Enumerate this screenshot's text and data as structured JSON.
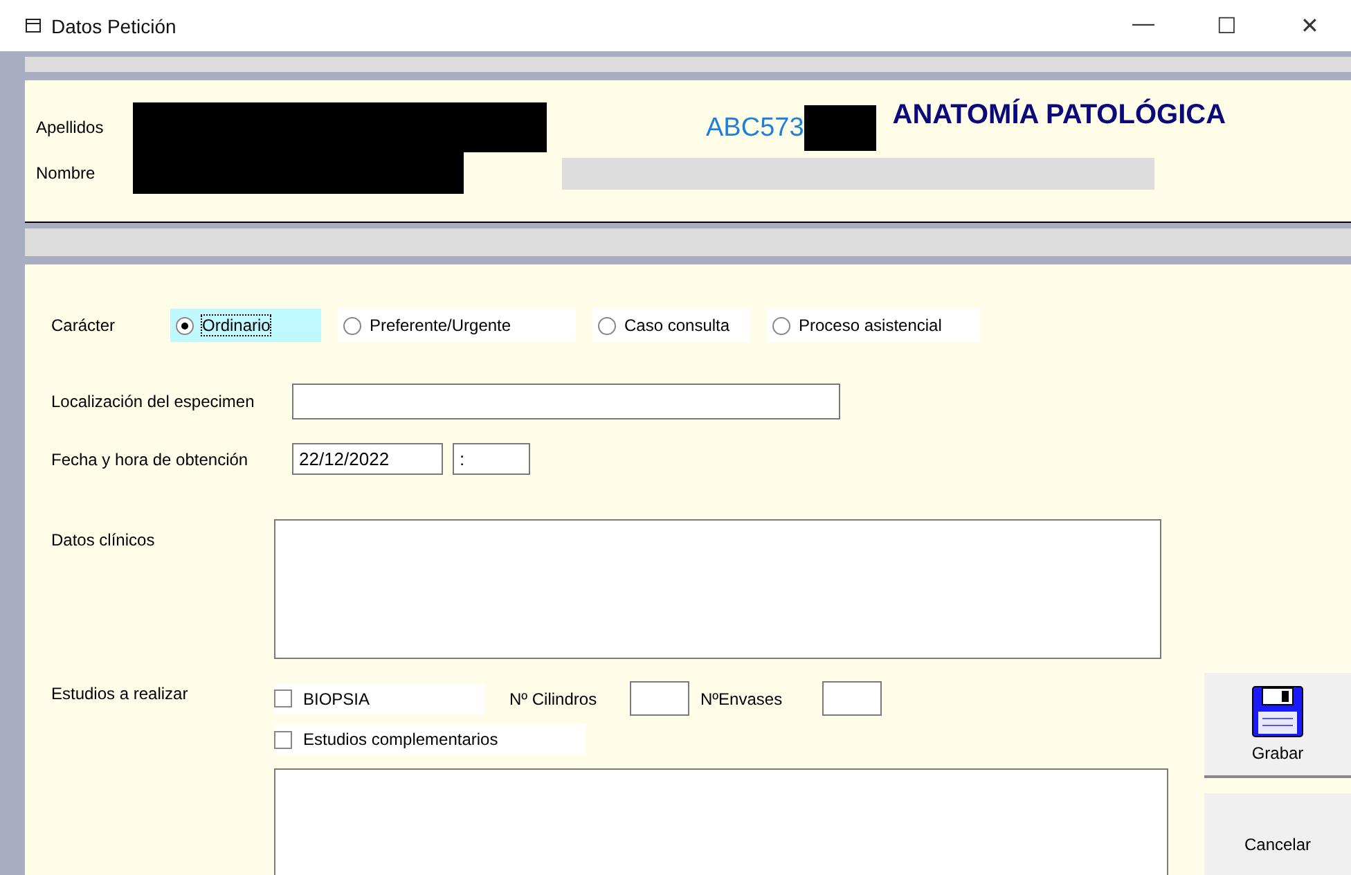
{
  "window": {
    "title": "Datos Petición",
    "controls": [
      "—",
      "☐",
      "✕"
    ]
  },
  "header": {
    "apellidos_label": "Apellidos",
    "nombre_label": "Nombre",
    "code": "ABC573",
    "department": "ANATOMÍA PATOLÓGICA"
  },
  "caracter": {
    "label": "Carácter",
    "options": [
      {
        "label": "Ordinario",
        "selected": true
      },
      {
        "label": "Preferente/Urgente",
        "selected": false
      },
      {
        "label": "Caso consulta",
        "selected": false
      },
      {
        "label": "Proceso asistencial",
        "selected": false
      }
    ]
  },
  "localizacion": {
    "label": "Localización del especimen"
  },
  "fecha": {
    "label": "Fecha y hora de obtención",
    "date": "22/12/2022",
    "time": ":"
  },
  "datos_clinicos": {
    "label": "Datos clínicos"
  },
  "estudios": {
    "label": "Estudios a realizar",
    "biopsia": {
      "label": "BIOPSIA",
      "checked": false
    },
    "cilindros_label": "Nº Cilindros",
    "envases_label": "NºEnvases",
    "complementarios": {
      "label": "Estudios complementarios",
      "checked": false
    }
  },
  "buttons": [
    {
      "kind": "save",
      "label": "Grabar"
    },
    {
      "kind": "cancel",
      "label": "Cancelar"
    }
  ]
}
